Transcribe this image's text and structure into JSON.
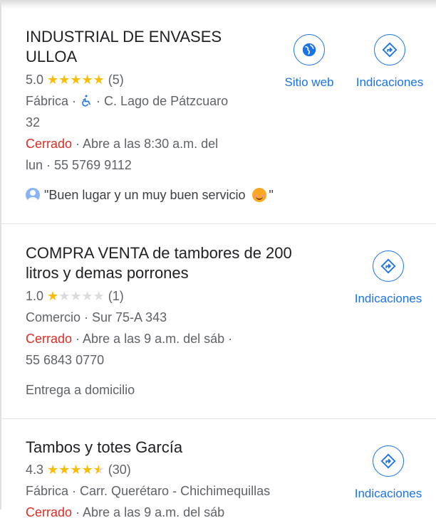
{
  "colors": {
    "accent": "#1a73e8",
    "star": "#fbbc04",
    "closed": "#d93025"
  },
  "listings": [
    {
      "title_line1": "INDUSTRIAL DE ENVASES",
      "title_line2": "ULLOA",
      "rating": "5.0",
      "stars": "★★★★★",
      "stars_off": "",
      "reviews": "(5)",
      "category": "Fábrica · ",
      "accessibility_icon": "wheelchair-icon",
      "address_part": " · C. Lago de Pátzcuaro",
      "address_cont": "32",
      "status": "Cerrado",
      "hours": " · Abre a las 8:30 a.m. del",
      "hours_cont": "lun · 55 5769 9112",
      "review_text": "\"Buen lugar y un muy buen servicio ",
      "review_end": "\"",
      "website_label": "Sitio web",
      "directions_label": "Indicaciones"
    },
    {
      "title_line1": "COMPRA VENTA de tambores de 200",
      "title_line2": "litros y demas porrones",
      "rating": "1.0",
      "stars": "★",
      "stars_off": "★★★★",
      "reviews": "(1)",
      "category": "Comercio · Sur 75-A 343",
      "status": "Cerrado",
      "hours": " · Abre a las 9 a.m. del sáb ·",
      "hours_cont": "55 6843 0770",
      "service": "Entrega a domicilio",
      "directions_label": "Indicaciones"
    },
    {
      "title_line1": "Tambos y totes García",
      "rating": "4.3",
      "stars": "★★★★",
      "stars_half": "★",
      "reviews": "(30)",
      "category": "Fábrica · Carr. Querétaro - Chichimequillas",
      "status": "Cerrado",
      "hours": " · Abre a las 9 a.m. del sáb",
      "directions_label": "Indicaciones"
    }
  ]
}
